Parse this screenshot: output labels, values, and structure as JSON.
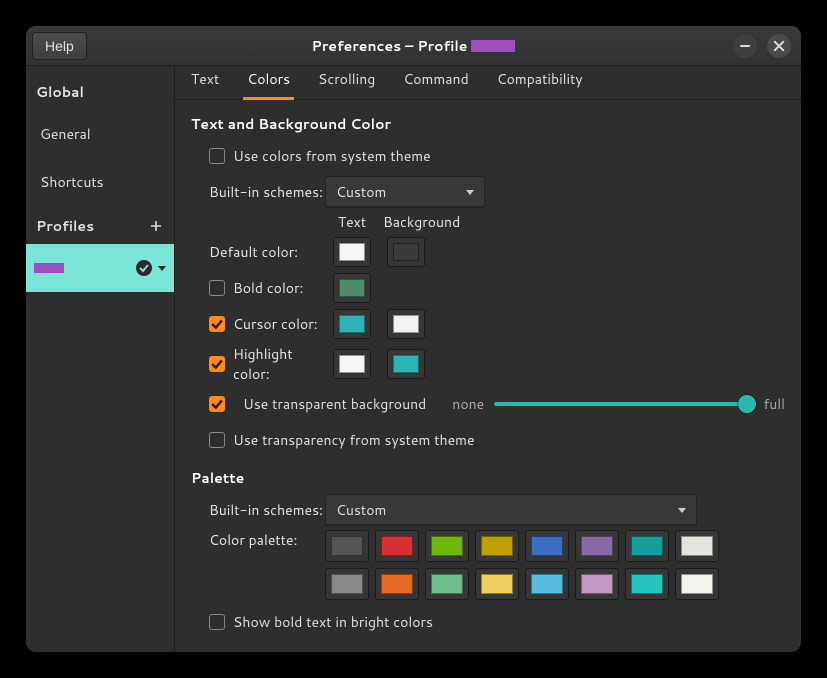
{
  "titlebar": {
    "help": "Help",
    "title_prefix": "Preferences – Profile",
    "profile_swatch": "#9e4fbf"
  },
  "sidebar": {
    "global": "Global",
    "general": "General",
    "shortcuts": "Shortcuts",
    "profiles": "Profiles"
  },
  "tabs": {
    "text": "Text",
    "colors": "Colors",
    "scrolling": "Scrolling",
    "command": "Command",
    "compatibility": "Compatibility"
  },
  "section1_title": "Text and Background Color",
  "use_system_colors": "Use colors from system theme",
  "builtin_label": "Built-in schemes:",
  "builtin_value": "Custom",
  "col_text": "Text",
  "col_bg": "Background",
  "default_color": "Default color:",
  "bold_color": "Bold color:",
  "cursor_color": "Cursor color:",
  "highlight_color": "Highlight color:",
  "use_transparent": "Use transparent background",
  "none": "none",
  "full": "full",
  "use_trans_system": "Use transparency from system theme",
  "palette_title": "Palette",
  "palette_builtin_value": "Custom",
  "color_palette_label": "Color palette:",
  "show_bold_bright": "Show bold text in bright colors",
  "swatches": {
    "default_text": "#f6f6f6",
    "default_bg": "#3a3a3a",
    "bold_text": "#4e8b6a",
    "cursor_text": "#2eb4b8",
    "cursor_bg": "#f2f2f2",
    "highlight_text": "#f6f6f6",
    "highlight_bg": "#2eb4b8"
  },
  "palette": [
    "#555555",
    "#d83030",
    "#6db80a",
    "#c0a000",
    "#3a6fc4",
    "#8a6aa6",
    "#169e9a",
    "#e4e4de",
    "#888888",
    "#e66a24",
    "#6ec08a",
    "#f0d060",
    "#54bde0",
    "#c49ac4",
    "#26c4c0",
    "#f4f4ee"
  ]
}
